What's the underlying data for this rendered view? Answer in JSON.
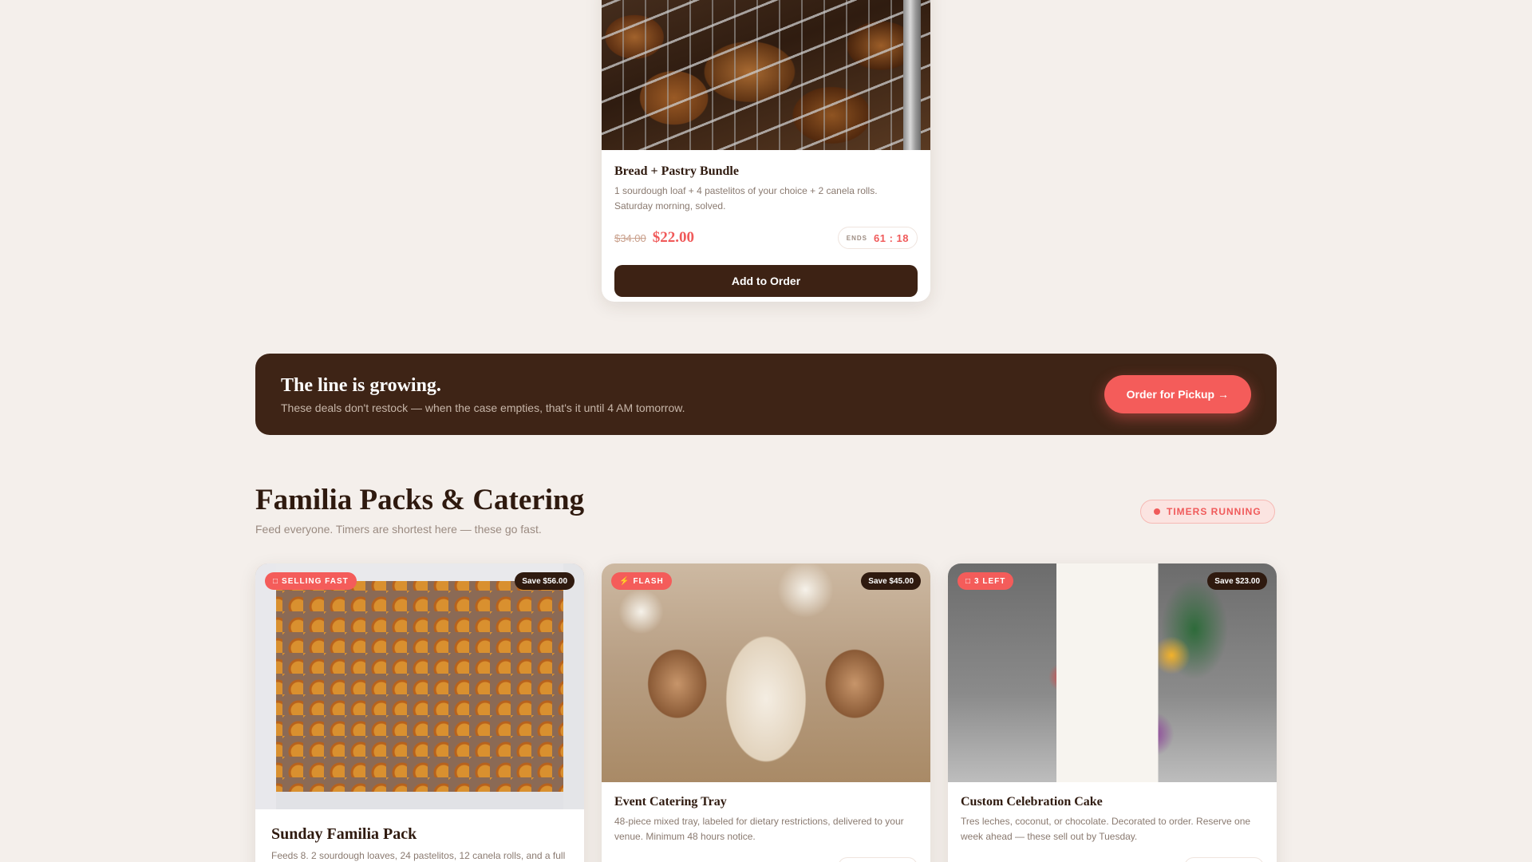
{
  "bundle": {
    "title": "Bread + Pastry Bundle",
    "description": "1 sourdough loaf + 4 pastelitos of your choice + 2 canela rolls. Saturday morning, solved.",
    "old_price": "$34.00",
    "new_price": "$22.00",
    "timer_label": "ENDS",
    "timer_value": "61 : 18",
    "button_label": "Add to Order"
  },
  "banner": {
    "title": "The line is growing.",
    "subtitle": "These deals don't restock — when the case empties, that's it until 4 AM tomorrow.",
    "button_label": "Order for Pickup →"
  },
  "section": {
    "title": "Familia Packs & Catering",
    "subtitle": "Feed everyone. Timers are shortest here — these go fast.",
    "status_pill": "TIMERS RUNNING"
  },
  "packs": [
    {
      "badge": "SELLING FAST",
      "badge_icon": "□",
      "save": "Save $56.00",
      "title": "Sunday Familia Pack",
      "description": "Feeds 8. 2 sourdough loaves, 24 pastelitos, 12 canela rolls, and a full"
    },
    {
      "badge": "FLASH",
      "badge_icon": "⚡",
      "save": "Save $45.00",
      "title": "Event Catering Tray",
      "description": "48-piece mixed tray, labeled for dietary restrictions, delivered to your venue. Minimum 48 hours notice."
    },
    {
      "badge": "3 LEFT",
      "badge_icon": "□",
      "save": "Save $23.00",
      "title": "Custom Celebration Cake",
      "description": "Tres leches, coconut, or chocolate. Decorated to order. Reserve one week ahead — these sell out by Tuesday."
    }
  ],
  "colors": {
    "background": "#f4efeb",
    "brown": "#3e2416",
    "accent": "#f45c5a"
  }
}
